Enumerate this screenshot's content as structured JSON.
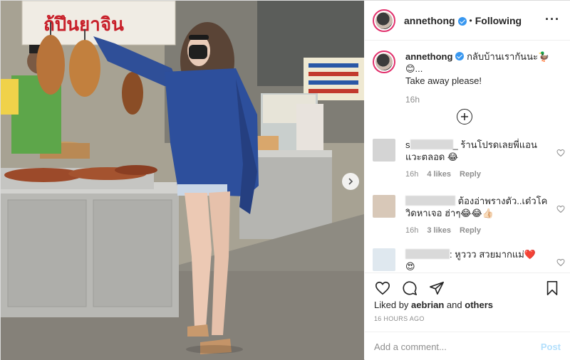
{
  "post": {
    "username": "annethong",
    "follow_status": "Following",
    "more_icon": "ellipsis-icon"
  },
  "caption": {
    "username": "annethong",
    "text": "กลับบ้านเรากันนะ🦆😊...",
    "text2": "Take away please!",
    "time": "16h"
  },
  "comments": [
    {
      "name": "s",
      "name_tail": "_",
      "text": "ร้านโปรดเลยพี่แอน แวะตลอด 😂",
      "time": "16h",
      "likes": "4 likes",
      "reply": "Reply",
      "avatar_color": "#d4d4d4"
    },
    {
      "name": "",
      "name_tail": "",
      "text": "ต้องอ่าพรางตัว..เด๋วโควิดหาเจอ ฮ่าๆ😂😂👍🏻",
      "time": "16h",
      "likes": "3 likes",
      "reply": "Reply",
      "avatar_color": "#d8c8b8"
    },
    {
      "name": "",
      "name_tail": ":",
      "text": "หูววว สวยมากแม่❤️",
      "emoji_line": "😍",
      "avatar_color": "#dfe8ef"
    }
  ],
  "stats": {
    "liked_prefix": "Liked by",
    "liked_user": "aebrian",
    "liked_and": "and",
    "liked_others": "others",
    "time_ago": "16 HOURS AGO"
  },
  "add_comment": {
    "placeholder": "Add a comment...",
    "post_label": "Post"
  },
  "colors": {
    "verified": "#3897f0",
    "story_ring": "#e1306c",
    "post_disabled": "#b2dffc"
  }
}
